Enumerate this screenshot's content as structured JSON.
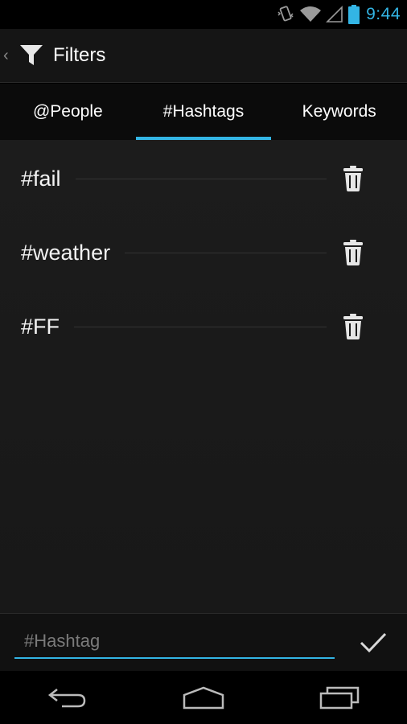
{
  "status_bar": {
    "time": "9:44",
    "icons": [
      "vibrate-icon",
      "wifi-icon",
      "signal-icon",
      "battery-icon"
    ]
  },
  "action_bar": {
    "title": "Filters",
    "icon": "filter-funnel-icon"
  },
  "tabs": [
    {
      "label": "@People",
      "active": false
    },
    {
      "label": "#Hashtags",
      "active": true
    },
    {
      "label": "Keywords",
      "active": false
    }
  ],
  "filters": [
    {
      "label": "#fail"
    },
    {
      "label": "#weather"
    },
    {
      "label": "#FF"
    }
  ],
  "input": {
    "placeholder": "#Hashtag",
    "value": ""
  },
  "colors": {
    "accent": "#33b5e5",
    "background": "#1a1a1a"
  }
}
